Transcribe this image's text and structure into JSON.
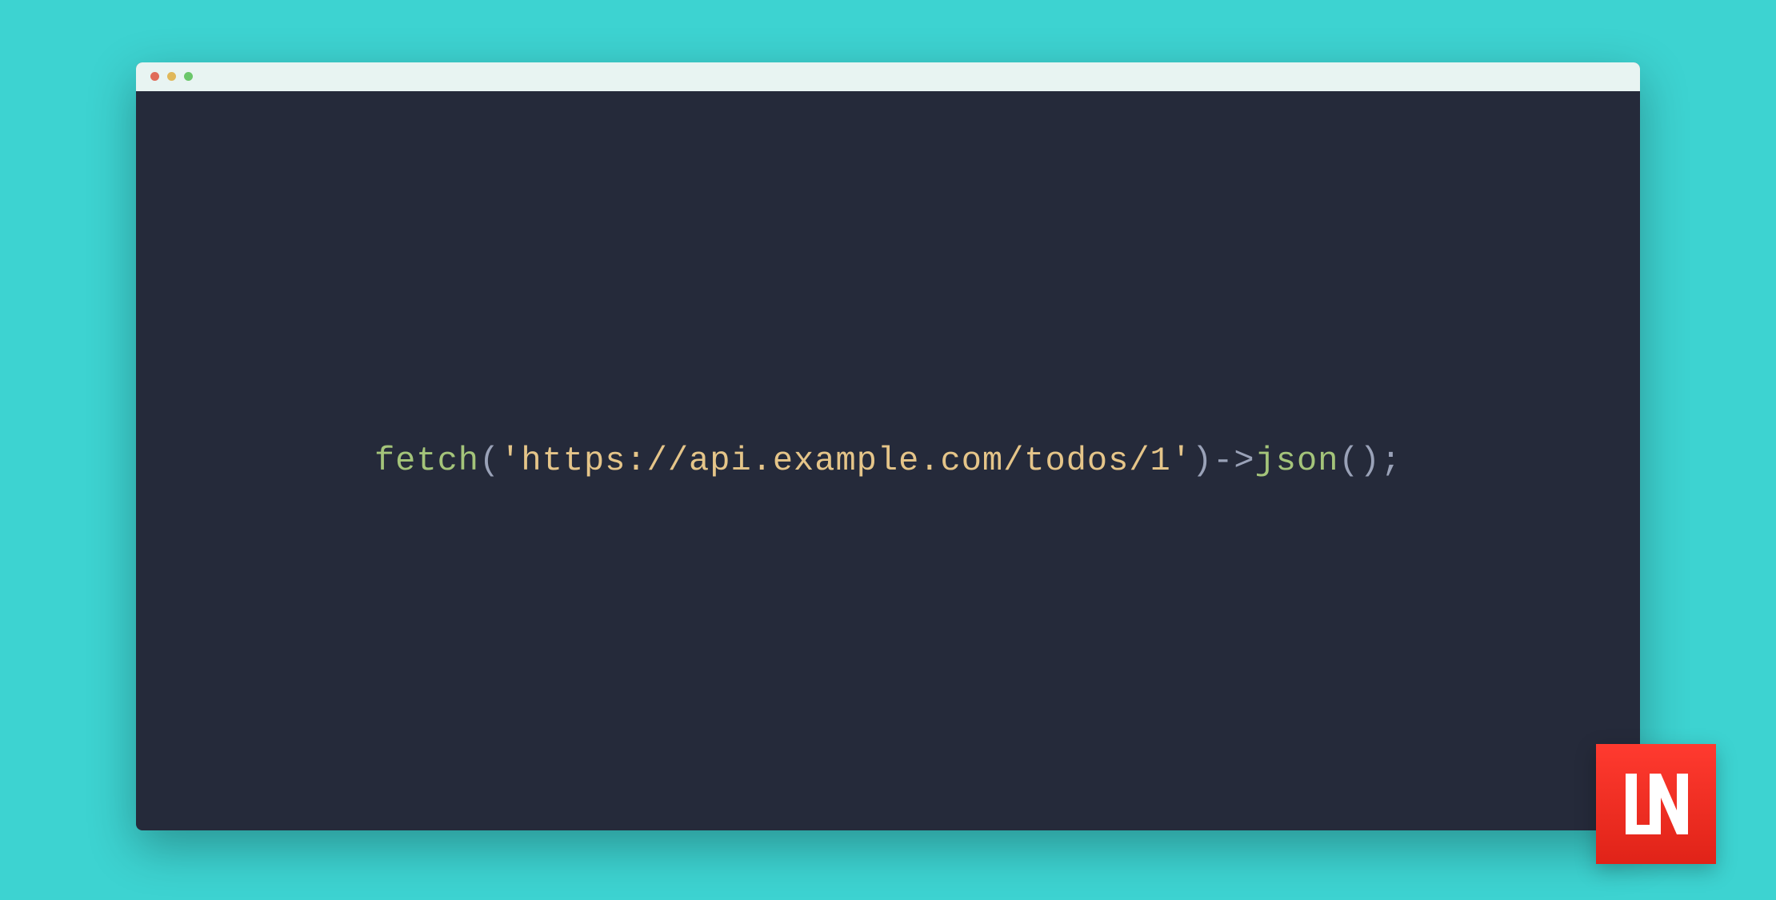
{
  "colors": {
    "background": "#3dd3d1",
    "window_bg": "#252a3a",
    "titlebar_bg": "#e8f4f2",
    "traffic_red": "#e06c5a",
    "traffic_yellow": "#e0b85a",
    "traffic_green": "#6bc76b",
    "logo_bg": "#ff3a2f"
  },
  "code": {
    "func": "fetch",
    "open_paren": "(",
    "string": "'https://api.example.com/todos/1'",
    "close_paren": ")",
    "arrow": "->",
    "method": "json",
    "call": "();"
  },
  "logo": {
    "text": "LN"
  }
}
